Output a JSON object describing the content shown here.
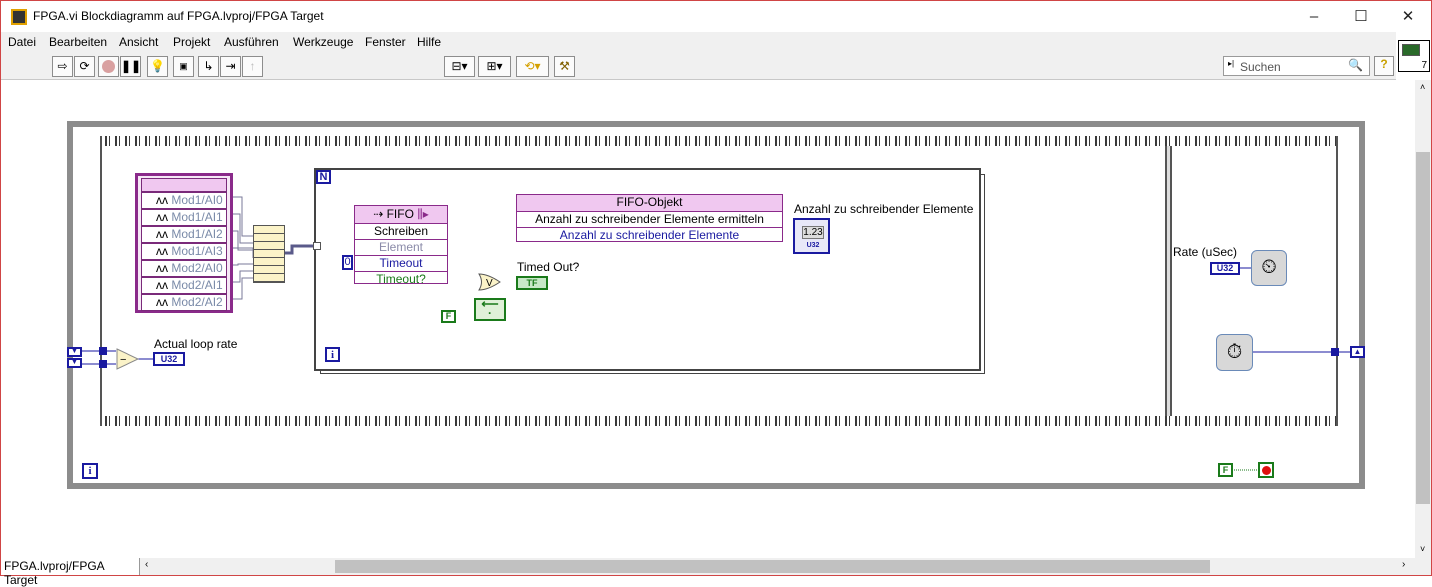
{
  "window": {
    "title": "FPGA.vi Blockdiagramm auf FPGA.lvproj/FPGA Target",
    "controls": [
      "–",
      "☐",
      "✕"
    ]
  },
  "menu": [
    "Datei",
    "Bearbeiten",
    "Ansicht",
    "Projekt",
    "Ausführen",
    "Werkzeuge",
    "Fenster",
    "Hilfe"
  ],
  "toolbar": {
    "font": "15pt Anwendungsschriftart",
    "search_placeholder": "Suchen",
    "help": "?",
    "icon_num": "7"
  },
  "status": "FPGA.lvproj/FPGA Target",
  "diagram": {
    "io_node_items": [
      "Mod1/AI0",
      "Mod1/AI1",
      "Mod1/AI2",
      "Mod1/AI3",
      "Mod2/AI0",
      "Mod2/AI1",
      "Mod2/AI2"
    ],
    "for_loop": {
      "count": "N",
      "iter": "i"
    },
    "fifo_write": {
      "title": "FIFO",
      "method": "Schreiben",
      "rows": [
        "Element",
        "Timeout",
        "Timeout?"
      ],
      "timeout_const": "0"
    },
    "fifo_obj": {
      "title": "FIFO-Objekt",
      "method": "Anzahl zu schreibender Elemente ermitteln",
      "output": "Anzahl zu schreibender Elemente"
    },
    "indicator_label": "Anzahl zu schreibender Elemente",
    "indicator_value": "1.23",
    "indicator_type": "U32",
    "timed_out_label": "Timed Out?",
    "tf": "TF",
    "false_const": "F",
    "or_sym": "V",
    "actual_rate_label": "Actual loop rate",
    "u32": "U32",
    "rate_label": "Rate (uSec)",
    "while_iter": "i",
    "stop_const": "F"
  },
  "colors": {
    "fifo": "#8a2a8a",
    "int": "#1a1aa0",
    "bool": "#1a7a1a",
    "frame": "#8c8c8c"
  }
}
